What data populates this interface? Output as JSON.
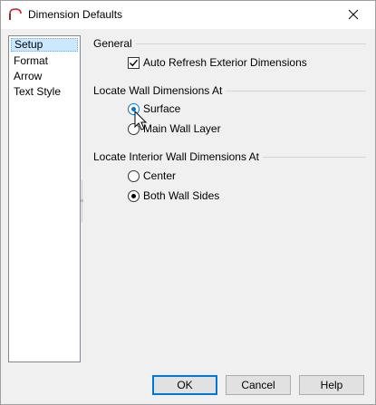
{
  "window": {
    "title": "Dimension Defaults"
  },
  "categories": [
    {
      "label": "Setup",
      "selected": true
    },
    {
      "label": "Format",
      "selected": false
    },
    {
      "label": "Arrow",
      "selected": false
    },
    {
      "label": "Text Style",
      "selected": false
    }
  ],
  "general": {
    "heading": "General",
    "auto_refresh": {
      "label": "Auto Refresh Exterior Dimensions",
      "checked": true
    }
  },
  "wall_dims": {
    "heading": "Locate Wall Dimensions At",
    "options": [
      {
        "label": "Surface",
        "selected": true
      },
      {
        "label": "Main Wall Layer",
        "selected": false
      }
    ]
  },
  "interior_dims": {
    "heading": "Locate Interior Wall Dimensions At",
    "options": [
      {
        "label": "Center",
        "selected": false
      },
      {
        "label": "Both Wall Sides",
        "selected": true
      }
    ]
  },
  "buttons": {
    "ok": "OK",
    "cancel": "Cancel",
    "help": "Help"
  },
  "colors": {
    "accent": "#0078d7",
    "selection": "#cce8ff"
  }
}
